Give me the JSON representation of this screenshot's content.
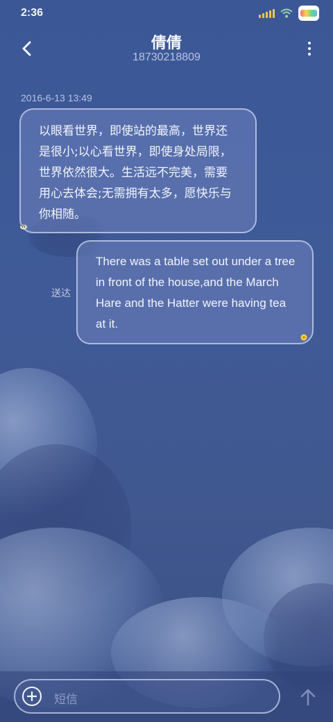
{
  "status_bar": {
    "time": "2:36"
  },
  "header": {
    "contact_name": "倩倩",
    "contact_number": "18730218809"
  },
  "conversation": {
    "timestamp": "2016-6-13 13:49",
    "messages": [
      {
        "direction": "incoming",
        "text": "以眼看世界，即使站的最高，世界还是很小;以心看世界，即使身处局限，世界依然很大。生活远不完美，需要用心去体会;无需拥有太多，愿快乐与你相随。"
      },
      {
        "direction": "outgoing",
        "text": "There was a table set out under a tree in front of the house,and the March Hare and the Hatter were having tea at it.",
        "status": "送达"
      }
    ]
  },
  "composer": {
    "placeholder": "短信"
  },
  "icons": {
    "back": "back-arrow-icon",
    "more": "more-vertical-icon",
    "add": "plus-icon",
    "send": "up-arrow-icon",
    "signal": "signal-icon",
    "wifi": "wifi-icon",
    "battery": "battery-icon"
  },
  "colors": {
    "background": "#3d5591",
    "bubble": "#6e82be",
    "bubble_border": "#c8d4f0",
    "signal_accent": "#f4c94a"
  }
}
